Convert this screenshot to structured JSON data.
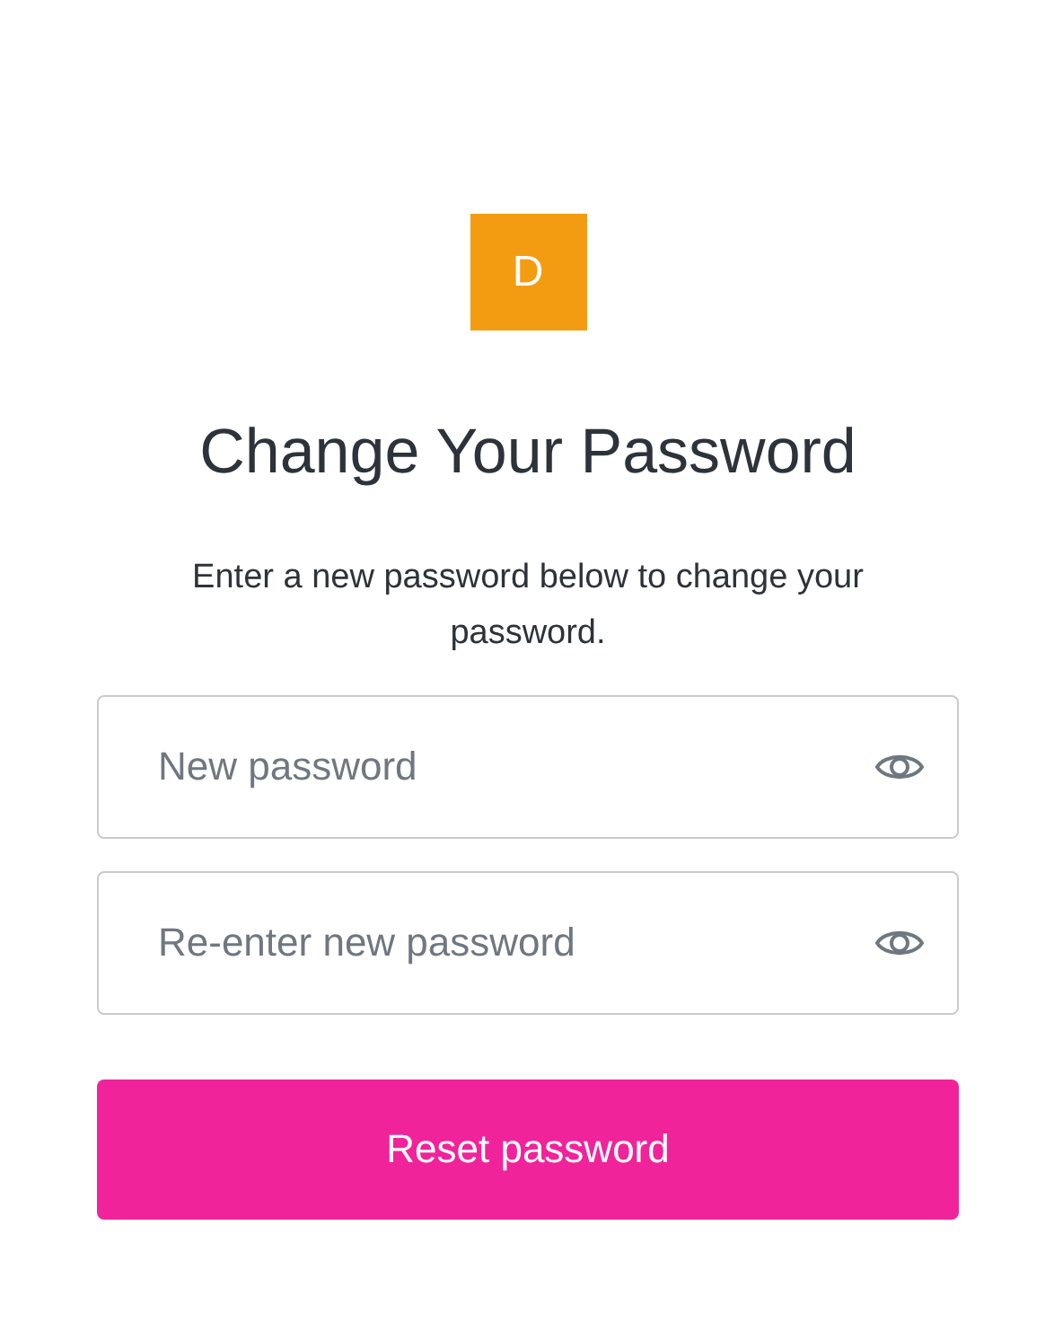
{
  "logo": {
    "letter": "D"
  },
  "title": "Change Your Password",
  "description": "Enter a new password below to change your password.",
  "fields": [
    {
      "placeholder": "New password"
    },
    {
      "placeholder": "Re-enter new password"
    }
  ],
  "submit": "Reset password"
}
